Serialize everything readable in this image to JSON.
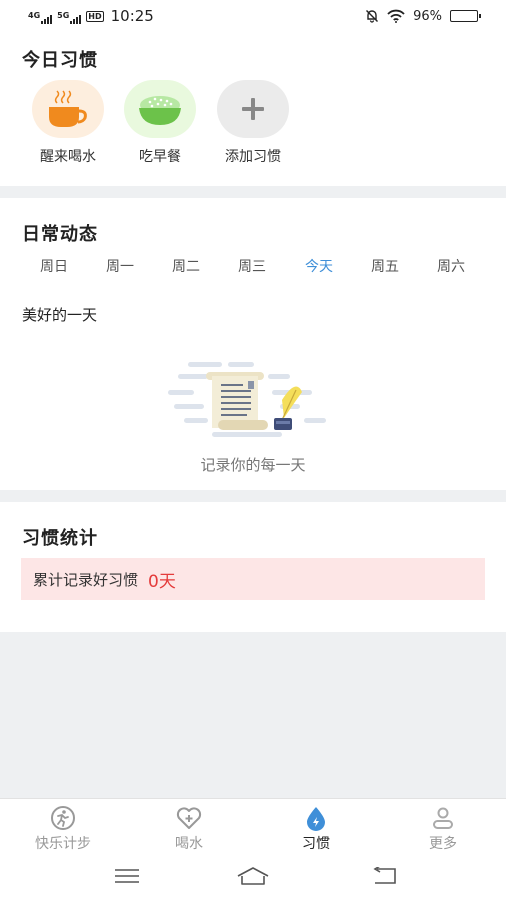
{
  "status_bar": {
    "sim1_label": "4G",
    "sim2_label": "5G",
    "hd_label": "HD",
    "time": "10:25",
    "battery_percent": "96%",
    "battery_level": 0.96
  },
  "today_habits": {
    "title": "今日习惯",
    "items": [
      {
        "label": "醒来喝水",
        "icon": "coffee-cup-icon",
        "bg": "#fdeede"
      },
      {
        "label": "吃早餐",
        "icon": "rice-bowl-icon",
        "bg": "#e9f9de"
      },
      {
        "label": "添加习惯",
        "icon": "plus-icon",
        "bg": "#ebebeb"
      }
    ]
  },
  "daily": {
    "title": "日常动态",
    "weekdays": [
      "周日",
      "周一",
      "周二",
      "周三",
      "今天",
      "周五",
      "周六"
    ],
    "active_index": 4,
    "day_title": "美好的一天",
    "empty_text": "记录你的每一天"
  },
  "stats": {
    "title": "习惯统计",
    "label": "累计记录好习惯",
    "value": "0天"
  },
  "tabbar": {
    "tabs": [
      {
        "label": "快乐计步",
        "icon": "running-icon"
      },
      {
        "label": "喝水",
        "icon": "heart-plus-icon"
      },
      {
        "label": "习惯",
        "icon": "droplet-bolt-icon"
      },
      {
        "label": "更多",
        "icon": "person-icon"
      }
    ],
    "active_index": 2
  },
  "colors": {
    "accent": "#3f8fd8",
    "stat_value": "#e43b3b",
    "stat_bg": "#fde6e6"
  }
}
